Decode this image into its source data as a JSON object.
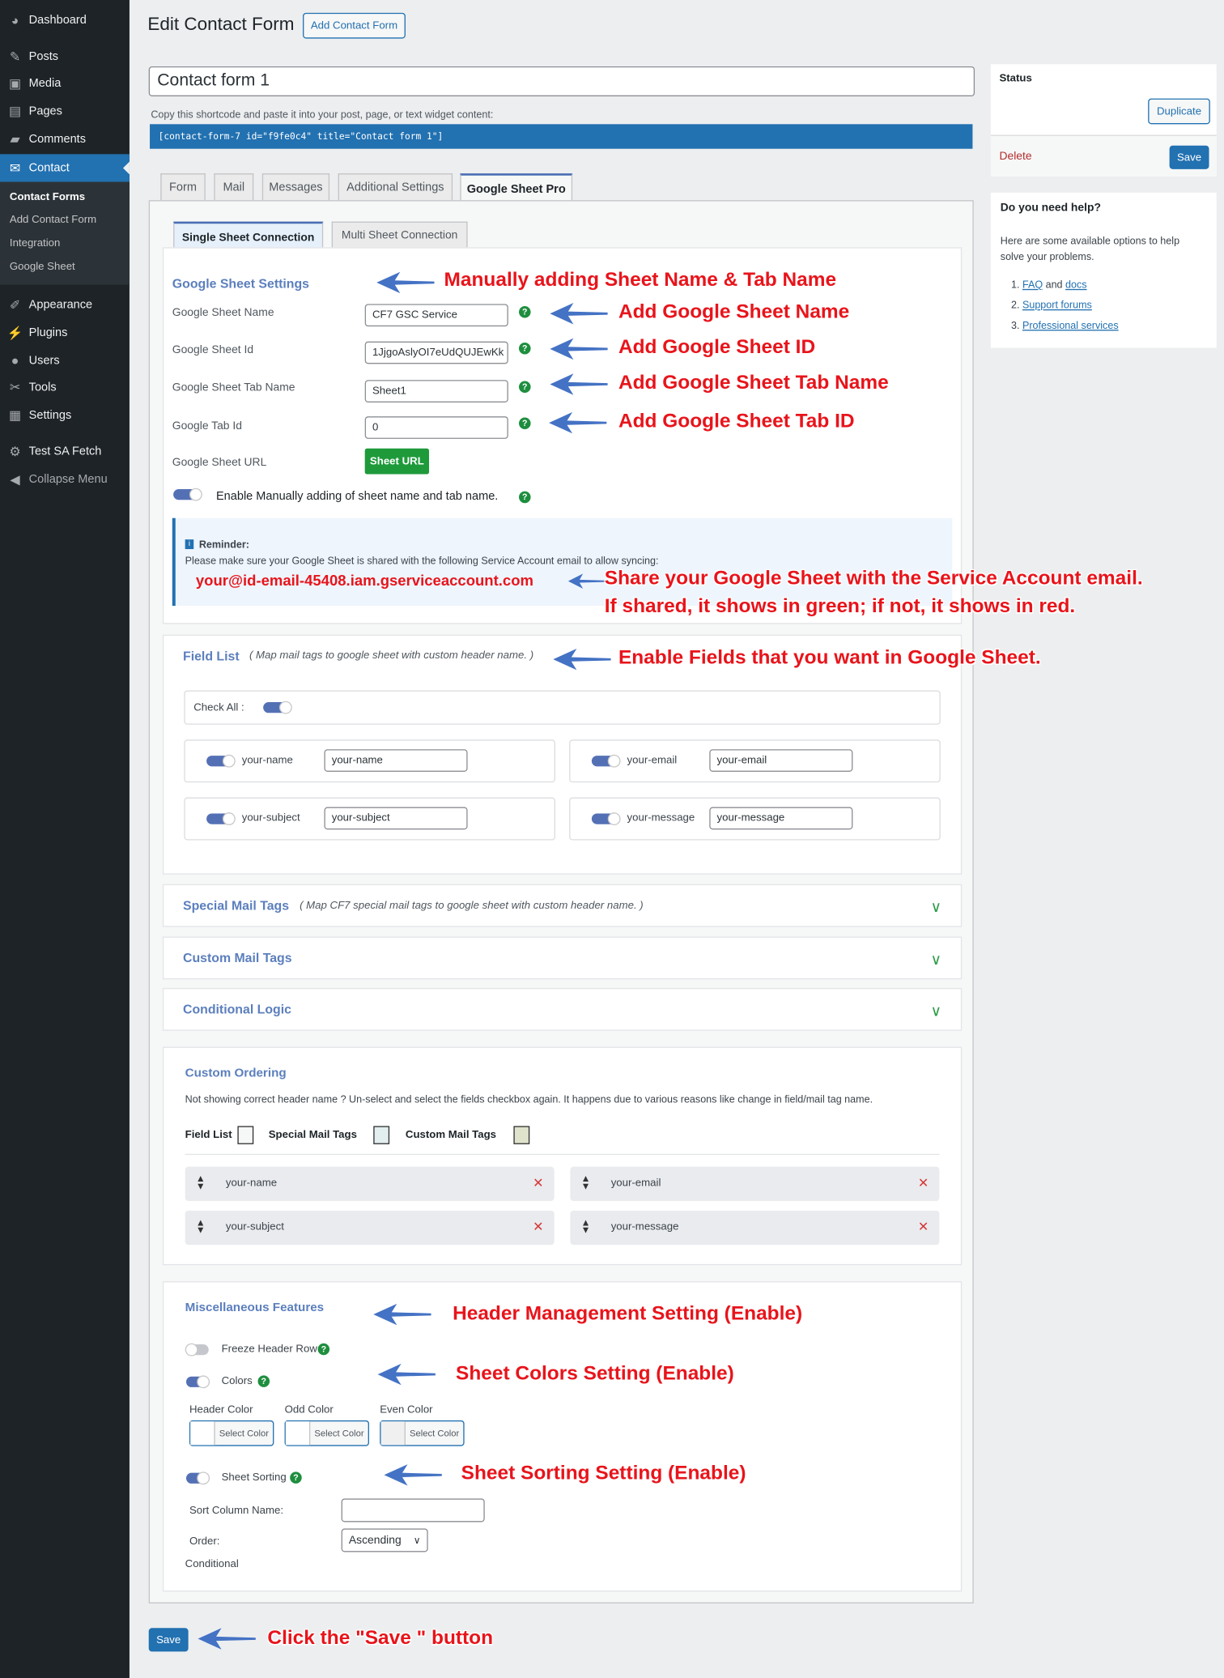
{
  "sidebar": {
    "items": [
      {
        "label": "Dashboard",
        "icon": "dashboard-icon"
      },
      {
        "label": "Posts",
        "icon": "pin-icon"
      },
      {
        "label": "Media",
        "icon": "media-icon"
      },
      {
        "label": "Pages",
        "icon": "pages-icon"
      },
      {
        "label": "Comments",
        "icon": "comment-icon"
      },
      {
        "label": "Contact",
        "icon": "envelope-icon"
      },
      {
        "label": "Appearance",
        "icon": "brush-icon"
      },
      {
        "label": "Plugins",
        "icon": "plug-icon"
      },
      {
        "label": "Users",
        "icon": "user-icon"
      },
      {
        "label": "Tools",
        "icon": "wrench-icon"
      },
      {
        "label": "Settings",
        "icon": "settings-icon"
      },
      {
        "label": "Test SA Fetch",
        "icon": "gear-icon"
      },
      {
        "label": "Collapse Menu",
        "icon": "collapse-icon"
      }
    ],
    "submenu": [
      "Contact Forms",
      "Add Contact Form",
      "Integration",
      "Google Sheet"
    ]
  },
  "header": {
    "title": "Edit Contact Form",
    "add_button": "Add Contact Form"
  },
  "form": {
    "title_value": "Contact form 1",
    "shortcode_hint": "Copy this shortcode and paste it into your post, page, or text widget content:",
    "shortcode": "[contact-form-7 id=\"f9fe0c4\" title=\"Contact form 1\"]"
  },
  "tabs": [
    "Form",
    "Mail",
    "Messages",
    "Additional Settings",
    "Google Sheet Pro"
  ],
  "subtabs": [
    "Single Sheet Connection",
    "Multi Sheet Connection"
  ],
  "sheet_settings": {
    "title": "Google Sheet Settings",
    "fields": [
      {
        "label": "Google Sheet Name",
        "value": "CF7 GSC Service"
      },
      {
        "label": "Google Sheet Id",
        "value": "1JjgoAslyOI7eUdQUJEwKk"
      },
      {
        "label": "Google Sheet Tab Name",
        "value": "Sheet1"
      },
      {
        "label": "Google Tab Id",
        "value": "0"
      }
    ],
    "url_label": "Google Sheet URL",
    "url_button": "Sheet URL",
    "manual_toggle_label": "Enable Manually adding of sheet name and tab name.",
    "manual_enabled": true,
    "reminder_title": "Reminder:",
    "reminder_text": "Please make sure your Google Sheet is shared with the following Service Account email to allow syncing:",
    "service_email": "your@id-email-45408.iam.gserviceaccount.com"
  },
  "field_list": {
    "title": "Field List",
    "hint": "( Map mail tags to google sheet with custom header name. )",
    "check_all": "Check All :",
    "fields": [
      {
        "tag": "your-name",
        "header": "your-name",
        "enabled": true
      },
      {
        "tag": "your-email",
        "header": "your-email",
        "enabled": true
      },
      {
        "tag": "your-subject",
        "header": "your-subject",
        "enabled": true
      },
      {
        "tag": "your-message",
        "header": "your-message",
        "enabled": true
      }
    ]
  },
  "accordions": [
    {
      "title": "Special Mail Tags",
      "hint": "( Map CF7 special mail tags to google sheet with custom header name. )"
    },
    {
      "title": "Custom Mail Tags"
    },
    {
      "title": "Conditional Logic"
    }
  ],
  "custom_ordering": {
    "title": "Custom Ordering",
    "note": "Not showing correct header name ? Un-select and select the fields checkbox again. It happens due to various reasons like change in field/mail tag name.",
    "legend": [
      {
        "label": "Field List",
        "color": "#f6f7f7"
      },
      {
        "label": "Special Mail Tags",
        "color": "#e3eeee"
      },
      {
        "label": "Custom Mail Tags",
        "color": "#dfe3cc"
      }
    ],
    "items": [
      "your-name",
      "your-email",
      "your-subject",
      "your-message"
    ]
  },
  "misc": {
    "title": "Miscellaneous Features",
    "freeze_label": "Freeze Header Row",
    "freeze_enabled": false,
    "colors_label": "Colors",
    "colors_enabled": true,
    "color_pickers": [
      {
        "label": "Header Color",
        "button": "Select Color"
      },
      {
        "label": "Odd Color",
        "button": "Select Color"
      },
      {
        "label": "Even Color",
        "button": "Select Color"
      }
    ],
    "sorting_label": "Sheet Sorting",
    "sorting_enabled": true,
    "sort_column_label": "Sort Column Name:",
    "sort_column_value": "",
    "order_label": "Order:",
    "order_value": "Ascending",
    "conditional_label": "Conditional"
  },
  "footer": {
    "save": "Save"
  },
  "status_box": {
    "title": "Status",
    "duplicate": "Duplicate",
    "delete": "Delete",
    "save": "Save"
  },
  "help_box": {
    "title": "Do you need help?",
    "text": "Here are some available options to help solve your problems.",
    "faq": "FAQ",
    "and": "and",
    "docs": "docs",
    "forums": "Support forums",
    "services": "Professional services"
  },
  "annotations": {
    "manual": "Manually adding Sheet Name & Tab Name",
    "name": "Add Google Sheet Name",
    "id": "Add Google Sheet ID",
    "tab_name": "Add Google Sheet Tab Name",
    "tab_id": "Add Google Sheet Tab ID",
    "share1": "Share your Google Sheet with the Service Account email.",
    "share2": "If shared, it shows in green; if not, it shows in red.",
    "fields": "Enable Fields that you want in Google Sheet.",
    "header": "Header Management Setting (Enable)",
    "colors": "Sheet Colors Setting (Enable)",
    "sorting": "Sheet Sorting Setting (Enable)",
    "save": "Click the \"Save \" button"
  },
  "colors": {
    "wp_blue": "#2271b1",
    "sidebar": "#1d2327",
    "annotation_red": "#e8141b",
    "arrow_blue": "#4472c4",
    "help_green": "#1e8e3e"
  }
}
